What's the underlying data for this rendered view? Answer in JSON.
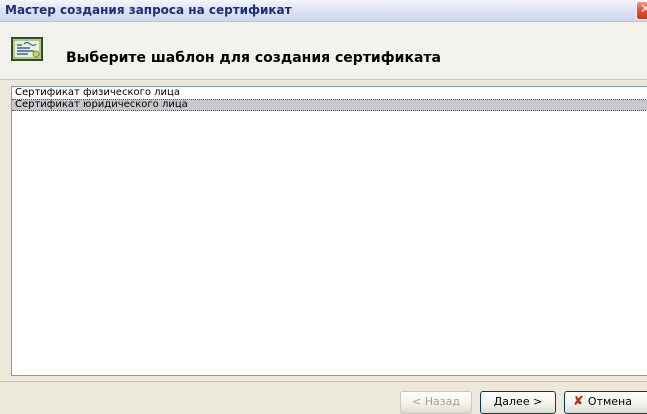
{
  "window": {
    "title": "Мастер создания запроса на сертификат",
    "close_glyph": "✕"
  },
  "header": {
    "title": "Выберите шаблон для создания сертификата",
    "icon": "certificate-icon"
  },
  "template_list": {
    "items": [
      {
        "label": "Сертификат физического лица",
        "selected": false
      },
      {
        "label": "Сертификат юридического лица",
        "selected": true
      }
    ]
  },
  "buttons": {
    "back_label": "< Назад",
    "next_label": "Далее >",
    "cancel_label": "Отмена",
    "cancel_icon": "✘"
  },
  "colors": {
    "title_text": "#1a2f7a",
    "selection": "#c8c8cc",
    "close_button": "#e0542e",
    "cancel_icon": "#cc2200"
  }
}
